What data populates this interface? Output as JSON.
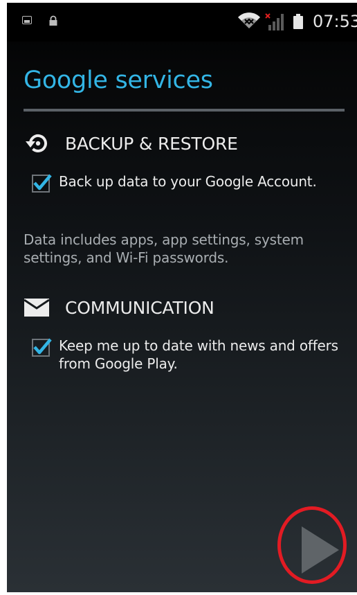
{
  "status_bar": {
    "time": "07:53",
    "icons": [
      "gallery-icon",
      "lock-icon",
      "wifi-icon",
      "no-signal-icon",
      "battery-icon"
    ]
  },
  "page": {
    "title": "Google services",
    "accent_color": "#33b5e5"
  },
  "backup": {
    "heading": "BACKUP & RESTORE",
    "icon": "restore-icon",
    "checkbox_label": "Back up data to your Google Account.",
    "checked": true,
    "info": "Data includes apps, app settings, system settings, and Wi-Fi passwords."
  },
  "communication": {
    "heading": "COMMUNICATION",
    "icon": "envelope-icon",
    "checkbox_label_line1": "Keep me up to date with news and offers",
    "checkbox_label_line2": "from Google Play.",
    "checked": true
  },
  "navigation": {
    "next_icon": "play-arrow-icon",
    "highlight_color": "#e21b23"
  }
}
